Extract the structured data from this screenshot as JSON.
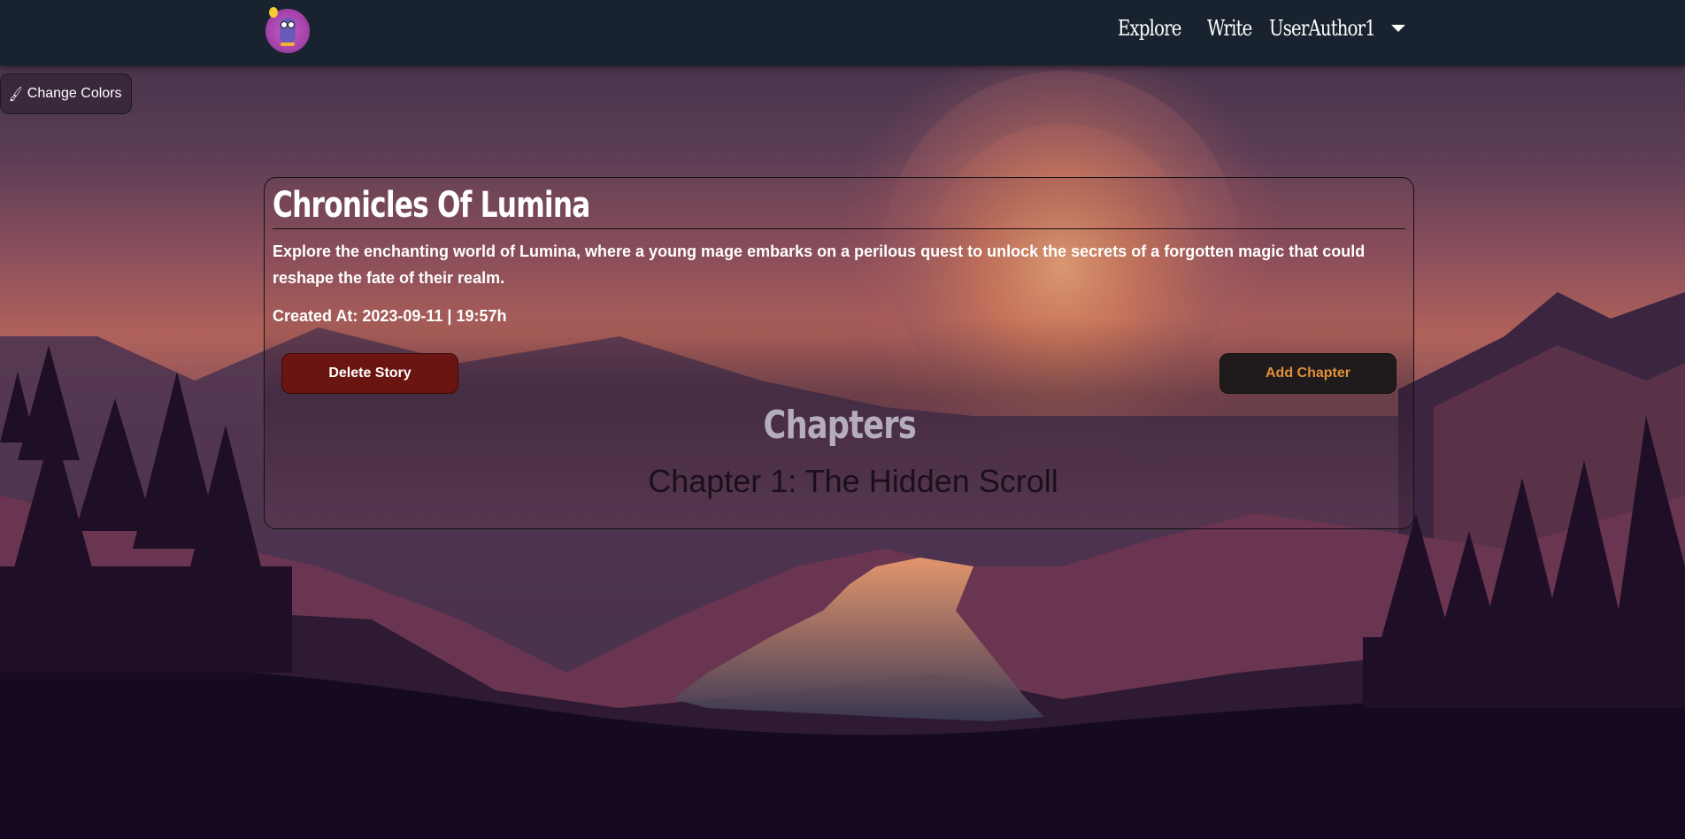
{
  "navbar": {
    "logo_name": "owl-logo",
    "links": {
      "explore": "Explore",
      "write": "Write",
      "user": "UserAuthor1"
    }
  },
  "theme_button": {
    "icon": "brush-icon",
    "label": "Change Colors"
  },
  "story": {
    "title": "Chronicles Of Lumina",
    "description": "Explore the enchanting world of Lumina, where a young mage embarks on a perilous quest to unlock the secrets of a forgotten magic that could reshape the fate of their realm.",
    "created_at": "Created At: 2023-09-11 | 19:57h",
    "delete_label": "Delete Story",
    "add_chapter_label": "Add Chapter",
    "chapters_heading": "Chapters",
    "chapters": [
      {
        "title": "Chapter 1: The Hidden Scroll"
      }
    ]
  },
  "colors": {
    "navbar": "#19232f",
    "delete_button": "#6b1512",
    "add_button_text": "#e0913a",
    "chapters_heading": "#b5adbf"
  }
}
